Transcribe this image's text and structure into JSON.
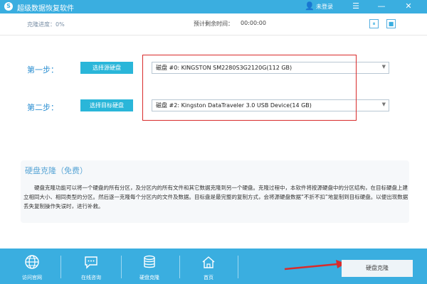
{
  "app": {
    "title": "超级数据恢复软件",
    "user_label": "未登录"
  },
  "info": {
    "progress_label": "克隆进度：0%",
    "time_label": "预计剩余时间：",
    "time_value": "00:00:00"
  },
  "steps": [
    {
      "label": "第一步：",
      "button": "选择源硬盘",
      "disk": "磁盘 #0: KINGSTON SM2280S3G2120G(112 GB)"
    },
    {
      "label": "第二步：",
      "button": "选择目标硬盘",
      "disk": "磁盘 #2: Kingston DataTraveler 3.0 USB Device(14 GB)"
    }
  ],
  "clone": {
    "title": "硬盘克隆（免费）",
    "description": "硬盘克隆功能可以将一个硬盘的所有分区，及分区内的所有文件和其它数据克隆到另一个硬盘。克隆过程中，本软件将按源硬盘中的分区结构，在目标硬盘上建立相同大小、相同类型的分区。然后逐一克隆每个分区内的文件及数据。目标盘是最完整的复制方式，会将源硬盘数据“不折不扣”地复制到目标硬盘。以便出现数据丢失复制操作失误时，进行补救。"
  },
  "toolbar": {
    "items": [
      {
        "label": "访问官网",
        "icon": "globe-icon"
      },
      {
        "label": "在线咨询",
        "icon": "chat-icon"
      },
      {
        "label": "硬盘克隆",
        "icon": "database-icon"
      },
      {
        "label": "首页",
        "icon": "home-icon"
      }
    ],
    "clone_button": "硬盘克隆"
  },
  "colors": {
    "accent": "#3aaee0",
    "highlight": "#d92b2b"
  }
}
